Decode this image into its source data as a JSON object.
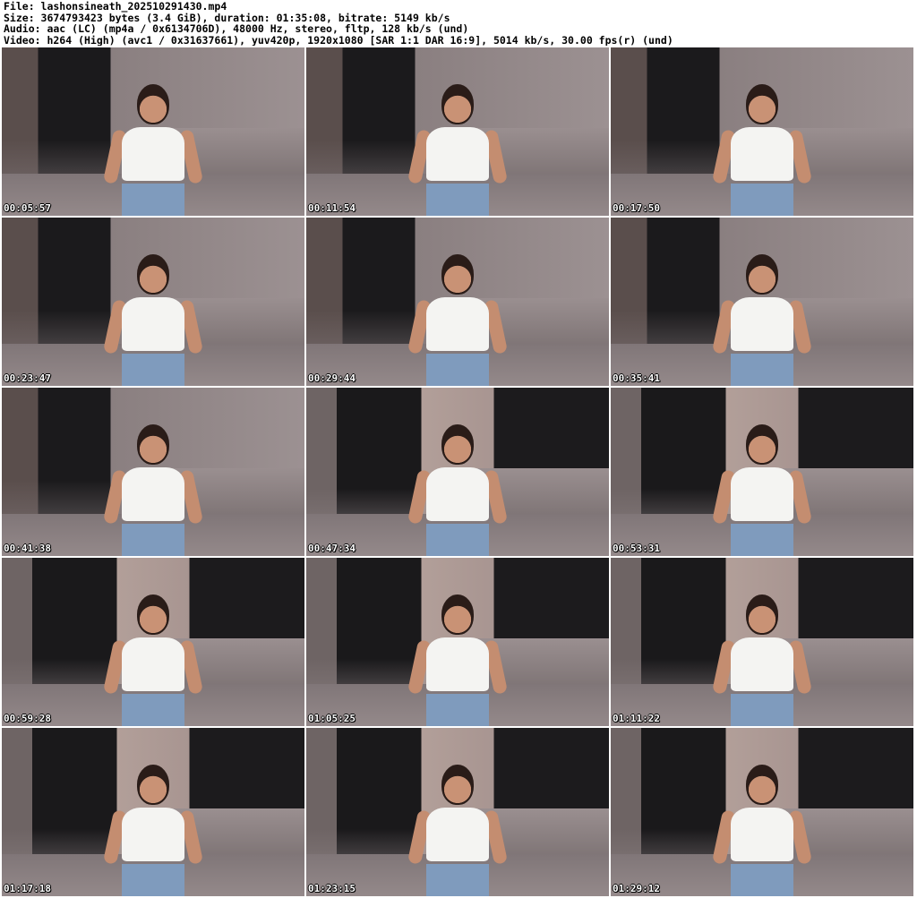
{
  "header": {
    "file": "File: lashonsineath_202510291430.mp4",
    "size": "Size: 3674793423 bytes (3.4 GiB), duration: 01:35:08, bitrate: 5149 kb/s",
    "audio": "Audio: aac (LC) (mp4a / 0x6134706D), 48000 Hz, stereo, fltp, 128 kb/s (und)",
    "video": "Video: h264 (High) (avc1 / 0x31637661), yuv420p, 1920x1080 [SAR 1:1 DAR 16:9], 5014 kb/s, 30.00 fps(r) (und)"
  },
  "thumbnails": [
    {
      "timestamp": "00:05:57"
    },
    {
      "timestamp": "00:11:54"
    },
    {
      "timestamp": "00:17:50"
    },
    {
      "timestamp": "00:23:47"
    },
    {
      "timestamp": "00:29:44"
    },
    {
      "timestamp": "00:35:41"
    },
    {
      "timestamp": "00:41:38"
    },
    {
      "timestamp": "00:47:34"
    },
    {
      "timestamp": "00:53:31"
    },
    {
      "timestamp": "00:59:28"
    },
    {
      "timestamp": "01:05:25"
    },
    {
      "timestamp": "01:11:22"
    },
    {
      "timestamp": "01:17:18"
    },
    {
      "timestamp": "01:23:15"
    },
    {
      "timestamp": "01:29:12"
    }
  ]
}
